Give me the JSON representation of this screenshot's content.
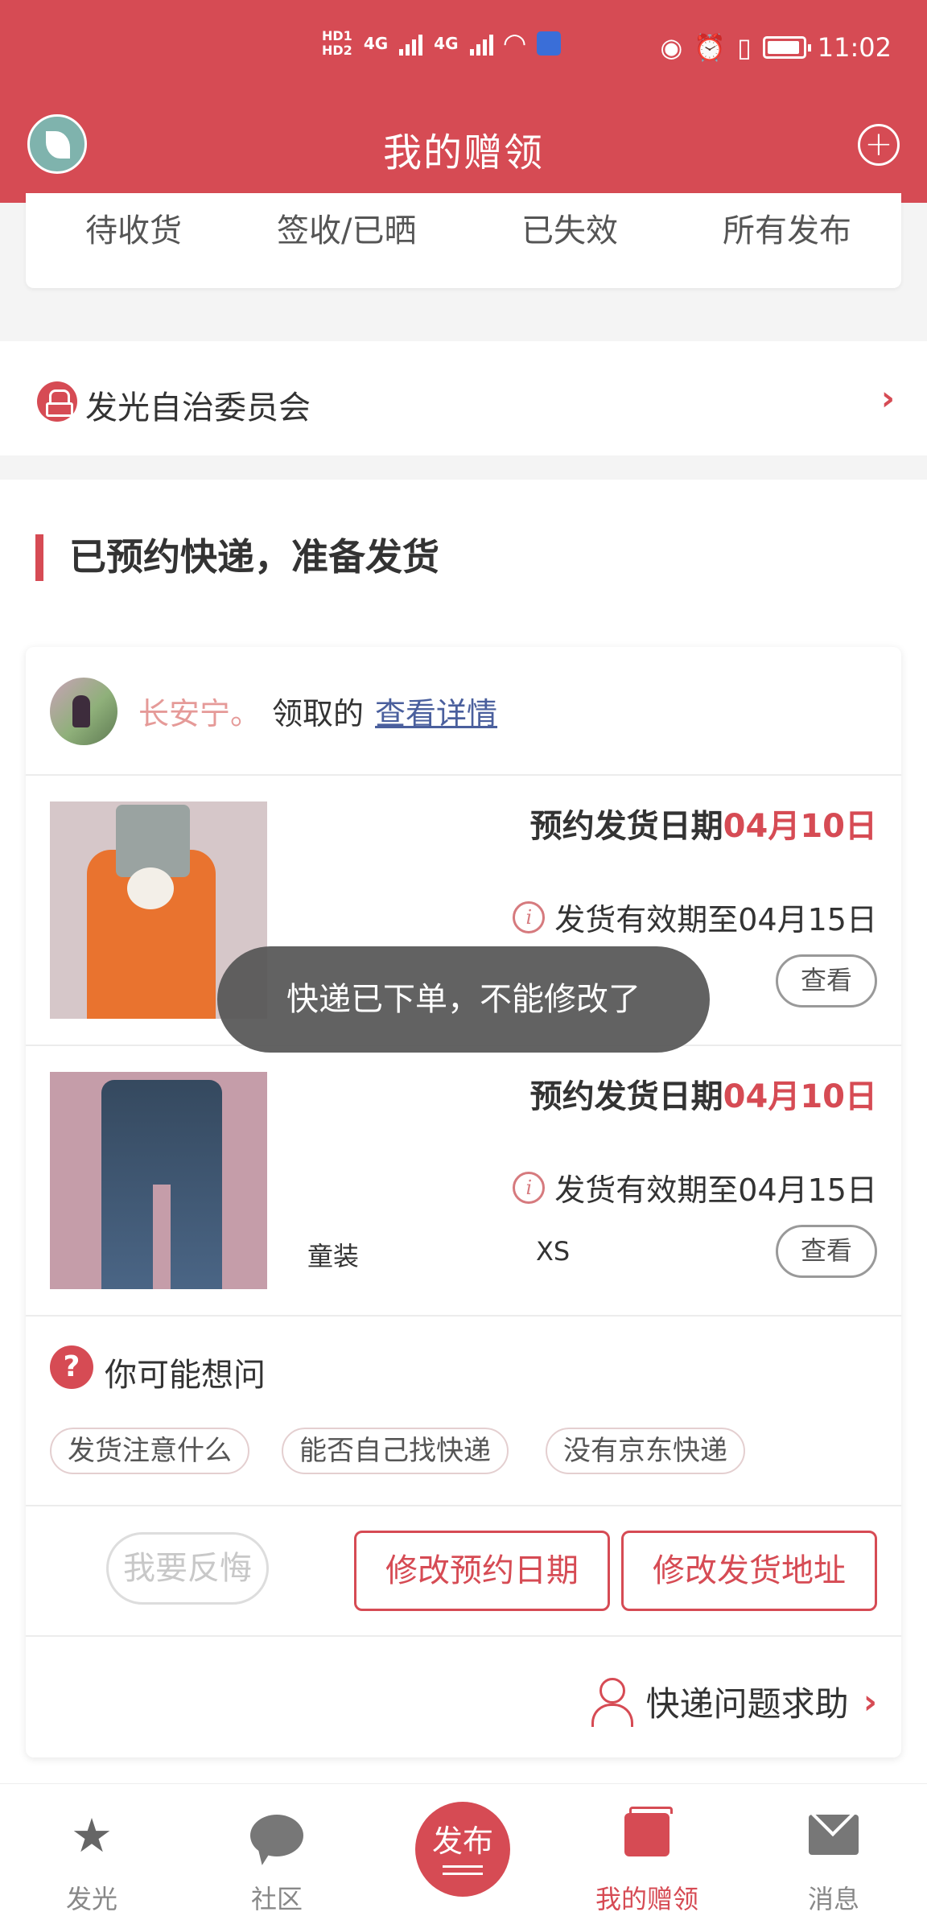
{
  "status_bar": {
    "sim1": "HD",
    "sim1_num": "1",
    "sim2": "HD",
    "sim2_num": "2",
    "net1": "4G",
    "net2": "4G",
    "time": "11:02"
  },
  "app_bar": {
    "title": "我的赠领",
    "add_symbol": "+"
  },
  "tabs": [
    "待收货",
    "签收/已晒",
    "已失效",
    "所有发布"
  ],
  "council": {
    "label": "发光自治委员会",
    "chevron": "›"
  },
  "section": {
    "title": "已预约快递，准备发货"
  },
  "order": {
    "receiver_name": "长安宁。",
    "receiver_action": "领取的",
    "details_link": "查看详情",
    "items": [
      {
        "ship_label": "预约发货日期",
        "ship_date": "04月10日",
        "expire_text": "发货有效期至04月15日",
        "info_symbol": "i",
        "category": "",
        "size": "",
        "view_label": "查看"
      },
      {
        "ship_label": "预约发货日期",
        "ship_date": "04月10日",
        "expire_text": "发货有效期至04月15日",
        "info_symbol": "i",
        "category": "童装",
        "size": "XS",
        "view_label": "查看"
      }
    ],
    "faq": {
      "icon_symbol": "?",
      "title": "你可能想问",
      "chips": [
        "发货注意什么",
        "能否自己找快递",
        "没有京东快递"
      ]
    },
    "actions": {
      "regret": "我要反悔",
      "modify_date": "修改预约日期",
      "modify_address": "修改发货地址"
    },
    "help": {
      "label": "快递问题求助",
      "chevron": "›"
    }
  },
  "toast": {
    "message": "快递已下单，不能修改了"
  },
  "tabbar": {
    "items": [
      {
        "label": "发光",
        "icon": "star-icon",
        "glyph": "★"
      },
      {
        "label": "社区",
        "icon": "chat-bubble-icon"
      },
      {
        "label": "发布",
        "icon": "publish-icon"
      },
      {
        "label": "我的赠领",
        "icon": "gift-book-icon"
      },
      {
        "label": "消息",
        "icon": "mail-icon"
      }
    ],
    "active": "我的赠领"
  },
  "colors": {
    "brand_red": "#d64b54",
    "link_blue": "#4a5f9d",
    "receiver_pink": "#e59a98"
  }
}
